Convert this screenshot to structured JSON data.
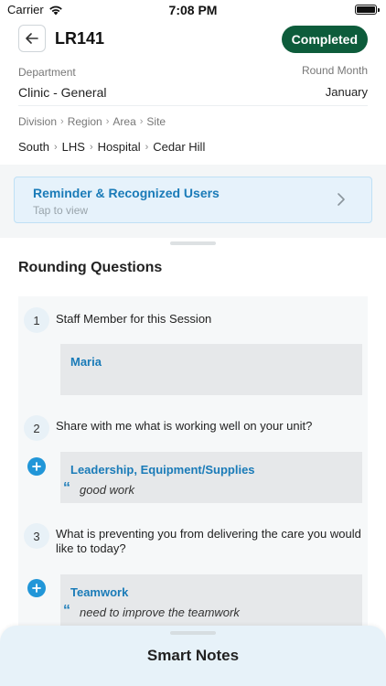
{
  "status_bar": {
    "carrier": "Carrier",
    "time": "7:08 PM"
  },
  "header": {
    "title": "LR141",
    "status": "Completed",
    "status_color": "#0d5c3b"
  },
  "details": {
    "department_label": "Department",
    "department_value": "Clinic - General",
    "round_month_label": "Round Month",
    "round_month_value": "January",
    "breadcrumb_labels": [
      "Division",
      "Region",
      "Area",
      "Site"
    ],
    "breadcrumb_values": [
      "South",
      "LHS",
      "Hospital",
      "Cedar Hill"
    ]
  },
  "reminder": {
    "title": "Reminder &  Recognized Users",
    "subtitle": "Tap to view"
  },
  "section": {
    "title": "Rounding Questions"
  },
  "questions": [
    {
      "number": "1",
      "text": "Staff Member for this Session",
      "answer_title": "Maria",
      "answer_note": ""
    },
    {
      "number": "2",
      "text": "Share with me what is working well on your unit?",
      "answer_title": "Leadership, Equipment/Supplies",
      "answer_note": "good work"
    },
    {
      "number": "3",
      "text": "What is preventing you from delivering the care you would like to today?",
      "answer_title": "Teamwork",
      "answer_note": "need to improve the teamwork"
    }
  ],
  "quote_mark": "“",
  "smart_notes": {
    "title": "Smart Notes"
  },
  "colors": {
    "accent": "#1a7bb8",
    "plus": "#2196d8",
    "reminder_bg": "#e6f2fb"
  },
  "icons": [
    "wifi-icon",
    "battery-icon",
    "back-arrow-icon",
    "chevron-right-icon",
    "plus-icon",
    "quote-icon"
  ]
}
